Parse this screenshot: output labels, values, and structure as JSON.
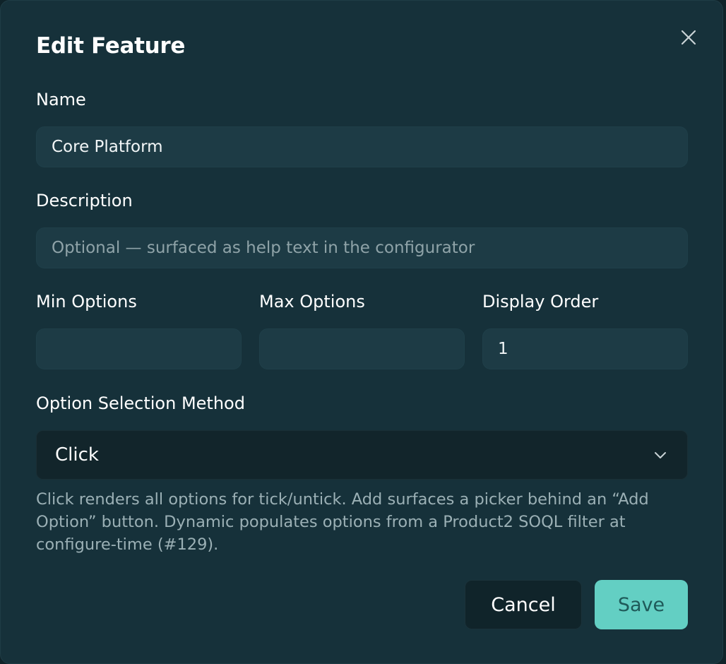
{
  "dialog": {
    "title": "Edit Feature",
    "close_icon": "close-icon"
  },
  "fields": {
    "name": {
      "label": "Name",
      "value": "Core Platform"
    },
    "description": {
      "label": "Description",
      "placeholder": "Optional — surfaced as help text in the configurator"
    },
    "min_options": {
      "label": "Min Options",
      "value": ""
    },
    "max_options": {
      "label": "Max Options",
      "value": ""
    },
    "display_order": {
      "label": "Display Order",
      "value": "1"
    },
    "selection_method": {
      "label": "Option Selection Method",
      "value": "Click",
      "help": "Click renders all options for tick/untick. Add surfaces a picker behind an “Add Option” button. Dynamic populates options from a Product2 SOQL filter at configure-time (#129)."
    }
  },
  "actions": {
    "cancel_label": "Cancel",
    "save_label": "Save"
  },
  "colors": {
    "modal_bg": "#16313a",
    "field_bg": "#1d3b45",
    "accent": "#63cfc3"
  }
}
